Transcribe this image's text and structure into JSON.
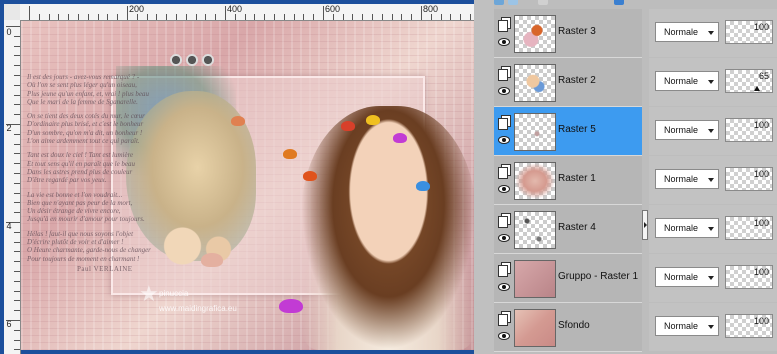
{
  "rulers": {
    "horizontal_labels": [
      "200",
      "400",
      "600",
      "800"
    ],
    "vertical_labels": [
      "0",
      "2",
      "4",
      "6"
    ]
  },
  "artwork": {
    "poem_lines": [
      "Il est des jours - avez-vous remarqué ? -",
      "Où l'on se sent plus léger qu'un oiseau,",
      "Plus jeune qu'un enfant, et, vrai ! plus beau",
      "Que le mari de la femme de Sganarelle.",
      "",
      "On se tient des deux cotés du mur, le cœur",
      "D'ordinaire plus brisé, et c'est le bonheur",
      "D'un sombre, qu'on m'a dit, un bonheur !",
      "L'on aime ardemment tout ce qui paraît.",
      "",
      "Tant est doux le ciel ! Tant est lumière",
      "Et tout sens qu'il en paraît que le beau",
      "Dans les astres prend plus de couleur",
      "D'être regardé par vos yeux.",
      "",
      "La vie est bonne et l'on voudrait...",
      "Bien que n'ayant pas peur de la mort,",
      "Un désir étrange de vivre encore,",
      "Jusqu'à en mourir d'amour pour toujours.",
      "",
      "Hélas ! faut-il que nous soyons l'objet",
      "D'écrire plutôt de voir et d'aimer !",
      "O Heure charmante, garde-nous de changer",
      "Pour toujours de moment en charmant !"
    ],
    "author": "Paul VERLAINE",
    "watermark_name": "pinuccia",
    "watermark_site": "www.maidingrafica.eu"
  },
  "layers": [
    {
      "name": "Raster 3",
      "blend": "Normale",
      "opacity": 100,
      "selected": false,
      "opacity_label": "100"
    },
    {
      "name": "Raster 2",
      "blend": "Normale",
      "opacity": 65,
      "selected": false,
      "opacity_label": "65"
    },
    {
      "name": "Raster 5",
      "blend": "Normale",
      "opacity": 100,
      "selected": true,
      "opacity_label": "100"
    },
    {
      "name": "Raster 1",
      "blend": "Normale",
      "opacity": 100,
      "selected": false,
      "opacity_label": "100"
    },
    {
      "name": "Raster 4",
      "blend": "Normale",
      "opacity": 100,
      "selected": false,
      "opacity_label": "100"
    },
    {
      "name": "Gruppo - Raster 1",
      "blend": "Normale",
      "opacity": 100,
      "selected": false,
      "opacity_label": "100"
    },
    {
      "name": "Sfondo",
      "blend": "Normale",
      "opacity": 100,
      "selected": false,
      "opacity_label": "100"
    }
  ],
  "colors": {
    "canvas_border": "#1c4f9c",
    "selection": "#3d9bf0",
    "panel": "#bdbdbd"
  }
}
